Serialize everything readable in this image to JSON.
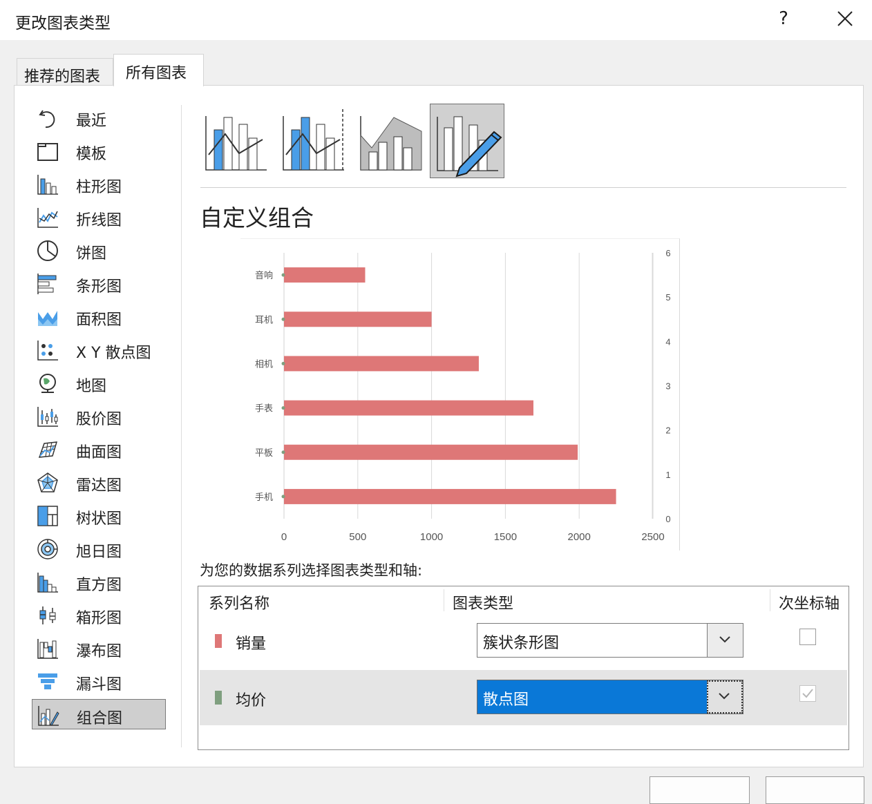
{
  "dialog": {
    "title": "更改图表类型",
    "help": "?"
  },
  "tabs": [
    {
      "label": "推荐的图表",
      "active": false
    },
    {
      "label": "所有图表",
      "active": true
    }
  ],
  "sidebar": {
    "items": [
      {
        "label": "最近",
        "icon": "recent-icon"
      },
      {
        "label": "模板",
        "icon": "template-icon"
      },
      {
        "label": "柱形图",
        "icon": "column-chart-icon"
      },
      {
        "label": "折线图",
        "icon": "line-chart-icon"
      },
      {
        "label": "饼图",
        "icon": "pie-chart-icon"
      },
      {
        "label": "条形图",
        "icon": "bar-chart-icon"
      },
      {
        "label": "面积图",
        "icon": "area-chart-icon"
      },
      {
        "label": "X Y 散点图",
        "icon": "scatter-chart-icon"
      },
      {
        "label": "地图",
        "icon": "map-chart-icon"
      },
      {
        "label": "股价图",
        "icon": "stock-chart-icon"
      },
      {
        "label": "曲面图",
        "icon": "surface-chart-icon"
      },
      {
        "label": "雷达图",
        "icon": "radar-chart-icon"
      },
      {
        "label": "树状图",
        "icon": "treemap-chart-icon"
      },
      {
        "label": "旭日图",
        "icon": "sunburst-chart-icon"
      },
      {
        "label": "直方图",
        "icon": "histogram-chart-icon"
      },
      {
        "label": "箱形图",
        "icon": "box-chart-icon"
      },
      {
        "label": "瀑布图",
        "icon": "waterfall-chart-icon"
      },
      {
        "label": "漏斗图",
        "icon": "funnel-chart-icon"
      },
      {
        "label": "组合图",
        "icon": "combo-chart-icon",
        "selected": true
      }
    ]
  },
  "subtypes": [
    {
      "icon": "clustered-column-line-icon",
      "selected": false
    },
    {
      "icon": "clustered-column-line-secondary-axis-icon",
      "selected": false
    },
    {
      "icon": "stacked-area-clustered-column-icon",
      "selected": false
    },
    {
      "icon": "custom-combination-icon",
      "selected": true
    }
  ],
  "main": {
    "section_title": "自定义组合",
    "instructions": "为您的数据系列选择图表类型和轴:"
  },
  "chart_data": {
    "type": "bar",
    "categories": [
      "手机",
      "平板",
      "手表",
      "相机",
      "耳机",
      "音响"
    ],
    "series": [
      {
        "name": "销量",
        "values": [
          2250,
          1990,
          1690,
          1320,
          1000,
          550
        ],
        "color": "#de7777"
      }
    ],
    "x_ticks": [
      "0",
      "500",
      "1000",
      "1500",
      "2000",
      "2500"
    ],
    "xlim": [
      0,
      2500
    ],
    "secondary_y_ticks": [
      "0",
      "1",
      "2",
      "3",
      "4",
      "5",
      "6"
    ],
    "secondary_ylim": [
      0,
      6
    ],
    "grid": "vertical"
  },
  "series_table": {
    "headers": {
      "name": "系列名称",
      "type": "图表类型",
      "axis": "次坐标轴"
    },
    "rows": [
      {
        "name": "销量",
        "color": "#de7777",
        "chart_type": "簇状条形图",
        "secondary_axis": false,
        "selected": false
      },
      {
        "name": "均价",
        "color": "#7f9f7f",
        "chart_type": "散点图",
        "secondary_axis": true,
        "selected": true
      }
    ]
  }
}
